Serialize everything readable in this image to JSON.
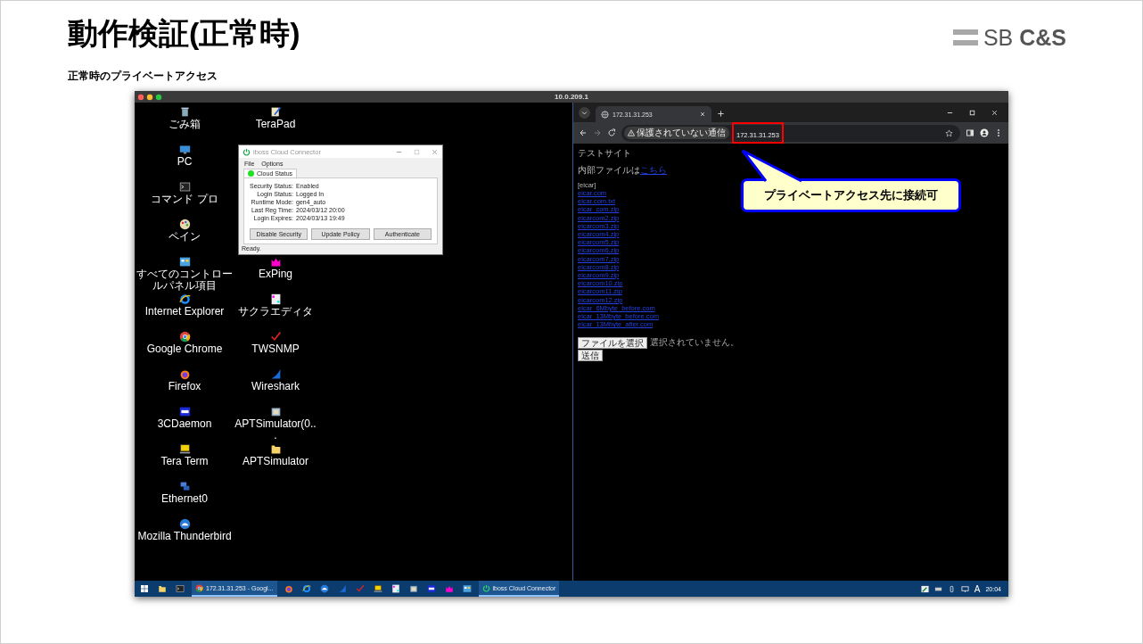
{
  "slide": {
    "title": "動作検証(正常時)",
    "logo": "SB **C&S**",
    "subtitle": "正常時のプライベートアクセス"
  },
  "remote_window": {
    "title": "10.0.209.1"
  },
  "desktop": {
    "column_1": [
      {
        "label": "ごみ箱"
      },
      {
        "label": "PC"
      },
      {
        "label": "コマンド プロ"
      },
      {
        "label": "ペイン"
      },
      {
        "label": "すべてのコントロールパネル項目"
      },
      {
        "label": "Internet Explorer"
      },
      {
        "label": "Google Chrome"
      },
      {
        "label": "Firefox"
      },
      {
        "label": "3CDaemon"
      },
      {
        "label": "Tera Term"
      },
      {
        "label": "Ethernet0"
      },
      {
        "label": "Mozilla Thunderbird"
      }
    ],
    "column_2": [
      {
        "label": "TeraPad"
      },
      {
        "label": "ExPing"
      },
      {
        "label": "サクラエディタ"
      },
      {
        "label": "TWSNMP"
      },
      {
        "label": "Wireshark"
      },
      {
        "label": "APTSimulator(0..."
      },
      {
        "label": "APTSimulator"
      }
    ]
  },
  "iboss_window": {
    "title": "iboss Cloud Connector",
    "menu": [
      "File",
      "Options"
    ],
    "tabs": [
      {
        "label": "Cloud Status",
        "selected": true,
        "color": "#22e022"
      }
    ],
    "fields": [
      {
        "label": "Security Status:",
        "value": "Enabled"
      },
      {
        "label": "Login Status:",
        "value": "Logged In"
      },
      {
        "label": "Runtime Mode:",
        "value": "gen4_auto"
      },
      {
        "label": "Last Reg Time:",
        "value": "2024/03/12 20:00"
      },
      {
        "label": "Login Expires:",
        "value": "2024/03/13 19:49"
      }
    ],
    "buttons": [
      "Disable Security",
      "Update Policy",
      "Authenticate"
    ],
    "status": "Ready."
  },
  "browser": {
    "tab_title": "172.31.31.253",
    "security_label": "保護されていない通信",
    "url": "172.31.31.253",
    "page": {
      "heading": "テストサイト",
      "internal_text": "内部ファイルは",
      "internal_link": "こちら",
      "section": "[eicar]",
      "links": [
        "eicar.com",
        "eicar.com.txt",
        "eicar_com.zip",
        "eicarcom2.zip",
        "eicarcom3.zip",
        "eicarcom4.zip",
        "eicarcom5.zip",
        "eicarcom6.zip",
        "eicarcom7.zip",
        "eicarcom8.zip",
        "eicarcom9.zip",
        "eicarcom10.zip",
        "eicarcom11.zip",
        "eicarcom12.zip",
        "eicar_6Mbyte_before.com",
        "eicar_13Mbyte_before.com",
        "eicar_13Mbyte_after.com"
      ],
      "file_button": "ファイルを選択",
      "file_status": "選択されていません。",
      "submit": "送信"
    }
  },
  "callout": {
    "text": "プライベートアクセス先に接続可"
  },
  "taskbar": {
    "tasks": [
      {
        "label": "172.31.31.253 - Googl...",
        "active": true
      },
      {
        "label": "iboss Cloud Connector",
        "active": true
      }
    ],
    "ime": "A",
    "clock": "20:04"
  }
}
